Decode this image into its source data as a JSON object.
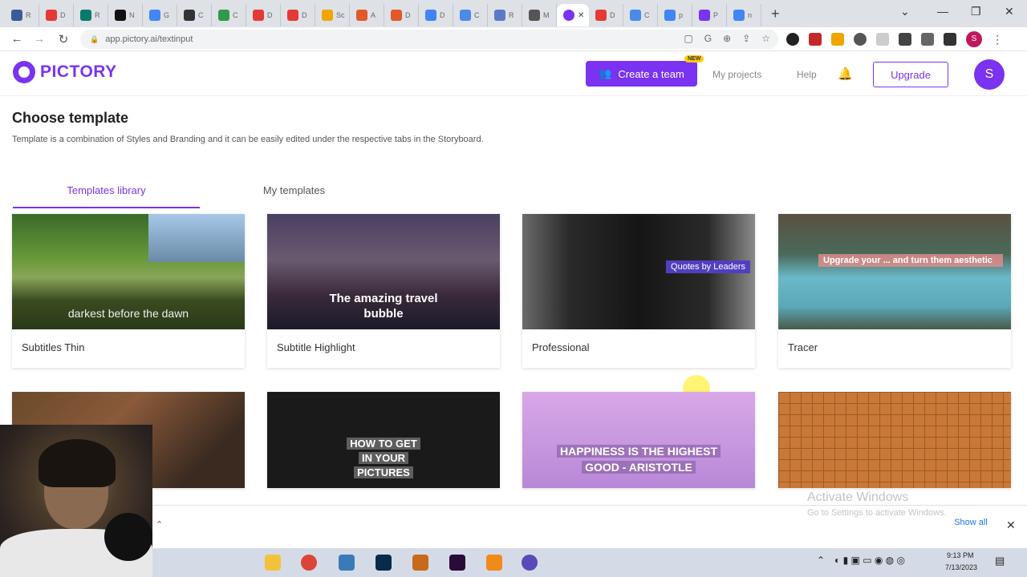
{
  "browser": {
    "tabs": [
      {
        "title": "R",
        "color": "#3a5a9a"
      },
      {
        "title": "D",
        "color": "#e53935"
      },
      {
        "title": "R",
        "color": "#0a7a6a"
      },
      {
        "title": "N",
        "color": "#111111"
      },
      {
        "title": "G",
        "color": "#4285f4"
      },
      {
        "title": "C",
        "color": "#333333"
      },
      {
        "title": "C",
        "color": "#2e9a4a"
      },
      {
        "title": "D",
        "color": "#e53935"
      },
      {
        "title": "D",
        "color": "#e53935"
      },
      {
        "title": "Sc",
        "color": "#f2a400"
      },
      {
        "title": "A",
        "color": "#e0592a"
      },
      {
        "title": "D",
        "color": "#e0592a"
      },
      {
        "title": "D",
        "color": "#4285f4"
      },
      {
        "title": "C",
        "color": "#4a8ae8"
      },
      {
        "title": "R",
        "color": "#5a7ac8"
      },
      {
        "title": "M",
        "color": "#555555"
      }
    ],
    "active_tab_color": "#7a33f0",
    "tabs_after": [
      {
        "title": "D",
        "color": "#e53935"
      },
      {
        "title": "C",
        "color": "#4a8ae8"
      },
      {
        "title": "p",
        "color": "#4285f4"
      },
      {
        "title": "P",
        "color": "#7a33f0"
      },
      {
        "title": "n",
        "color": "#4285f4"
      }
    ],
    "url": "app.pictory.ai/textinput"
  },
  "header": {
    "logo_text": "PICTORY",
    "create_team_label": "Create a team",
    "new_badge": "NEW",
    "my_projects": "My projects",
    "help": "Help",
    "upgrade": "Upgrade",
    "avatar_letter": "S",
    "brand_color": "#7a33f0"
  },
  "content": {
    "heading": "Choose template",
    "description": "Template is a combination of Styles and Branding and it can be easily edited under the respective tabs in the Storyboard.",
    "tab_library": "Templates library",
    "tab_my": "My templates",
    "templates": [
      {
        "name": "Subtitles Thin",
        "caption": "darkest before the dawn"
      },
      {
        "name": "Subtitle Highlight",
        "caption_line1": "The amazing travel",
        "caption_line2": "bubble"
      },
      {
        "name": "Professional",
        "caption": "Quotes by Leaders"
      },
      {
        "name": "Tracer",
        "caption": "Upgrade your ... and turn them aesthetic"
      }
    ],
    "row2": [
      {
        "caption_line1": "HOW TO GET",
        "caption_line2": "IN YOUR",
        "caption_line3": "PICTURES"
      },
      {
        "caption_line1": "HAPPINESS IS THE HIGHEST",
        "caption_line2": "GOOD - ARISTOTLE"
      }
    ]
  },
  "downloads": {
    "show_all": "Show all",
    "watermark_title": "Activate Windows",
    "watermark_sub": "Go to Settings to activate Windows."
  },
  "taskbar": {
    "time": "9:13 PM",
    "date": "7/13/2023"
  }
}
